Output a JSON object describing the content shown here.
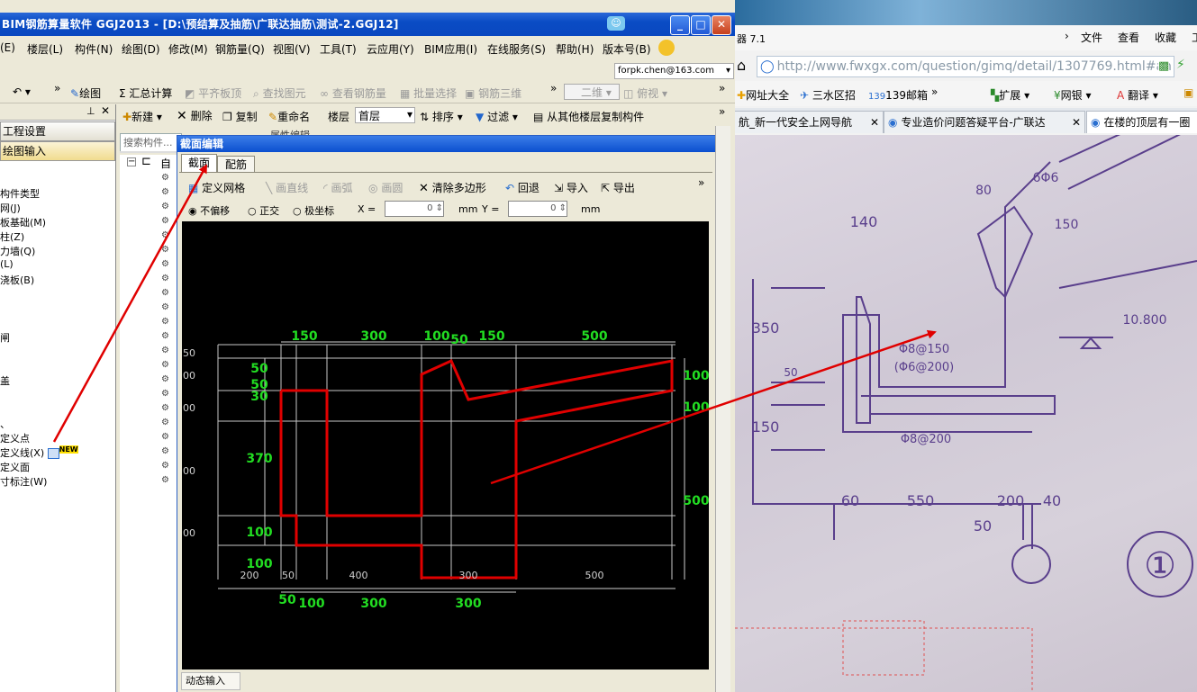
{
  "app": {
    "title": "BIM钢筋算量软件 GGJ2013 - [D:\\预结算及抽筋\\广联达抽筋\\测试-2.GGJ12]",
    "window_buttons": {
      "minimize": "_",
      "maximize": "□",
      "close": "✕"
    },
    "menu": [
      "(E)",
      "楼层(L)",
      "构件(N)",
      "绘图(D)",
      "修改(M)",
      "钢筋量(Q)",
      "视图(V)",
      "工具(T)",
      "云应用(Y)",
      "BIM应用(I)",
      "在线服务(S)",
      "帮助(H)",
      "版本号(B)"
    ],
    "account": "forpk.chen@163.com",
    "toolbar1": [
      "绘图",
      "Σ 汇总计算",
      "平齐板顶",
      "查找图元",
      "查看钢筋量",
      "批量选择",
      "钢筋三维",
      "二维",
      "俯视"
    ],
    "toolbar2": [
      "新建",
      "删除",
      "复制",
      "重命名",
      "楼层",
      "首层",
      "排序",
      "过滤",
      "从其他楼层复制构件"
    ],
    "left_panel": {
      "pin": "⊥",
      "close": "✕",
      "buttons": [
        "工程设置",
        "绘图输入"
      ],
      "items": [
        "构件类型",
        "网(J)",
        "板基础(M)",
        "柱(Z)",
        "力墙(Q)",
        "(L)",
        "浇板(B)",
        "闸",
        "盖",
        "定义点",
        "定义线(X)",
        "定义面",
        "寸标注(W)"
      ],
      "new_badge": "NEW"
    },
    "search_placeholder": "搜索构件...",
    "tree_root": "自",
    "tree_peek": "属性编辑"
  },
  "dialog": {
    "title": "截面编辑",
    "tabs": [
      "截面",
      "配筋"
    ],
    "toolbar": [
      "定义网格",
      "画直线",
      "画弧",
      "画圆",
      "清除多边形",
      "回退",
      "导入",
      "导出"
    ],
    "options": {
      "radios": [
        "不偏移",
        "正交",
        "极坐标"
      ],
      "x_label": "X =",
      "x_value": "0",
      "y_label": "Y =",
      "y_value": "0",
      "unit": "mm"
    },
    "dynamic_input": "动态输入",
    "drawing": {
      "top_dims": [
        "150",
        "300",
        "100",
        "50",
        "150",
        "500"
      ],
      "bottom_dims": [
        "50",
        "100",
        "300",
        "300"
      ],
      "grid_bottom_labels": [
        "200",
        "50",
        "400",
        "300",
        "500"
      ],
      "left_green": [
        "50",
        "50",
        "30",
        "370",
        "100",
        "100"
      ],
      "left_grey": [
        "50",
        "00",
        "00",
        "00",
        "00"
      ],
      "right_dims": [
        "100",
        "100",
        "500"
      ]
    }
  },
  "browser": {
    "title_fragment": "器 7.1",
    "title_menu": [
      "文件",
      "查看",
      "收藏",
      "工"
    ],
    "url_domain": "http://www.fwxgx.com",
    "url_path": "/question/gimq/detail/1307769.html#an",
    "favorites": [
      "网址大全",
      "三水区招",
      "139邮箱",
      "扩展",
      "网银",
      "翻译"
    ],
    "tabs": [
      "航_新一代安全上网导航",
      "专业造价问题答疑平台-广联达",
      "在楼的顶层有一圈"
    ],
    "photo_labels": {
      "a": "6Φ6",
      "b": "80",
      "c": "150",
      "d": "140",
      "e": "350",
      "f": "10.800",
      "g": "Φ8@150",
      "h": "(Φ6@200)",
      "i": "Φ8@200",
      "j": "60",
      "k": "550",
      "l": "200",
      "m": "40",
      "n": "50",
      "o": "150",
      "p": "50",
      "q": "①"
    }
  },
  "colors": {
    "accent_red": "#e00000",
    "dim_green": "#22dd22",
    "xp_blue": "#0a4cc4",
    "photo_ink": "#5a3f8c"
  }
}
